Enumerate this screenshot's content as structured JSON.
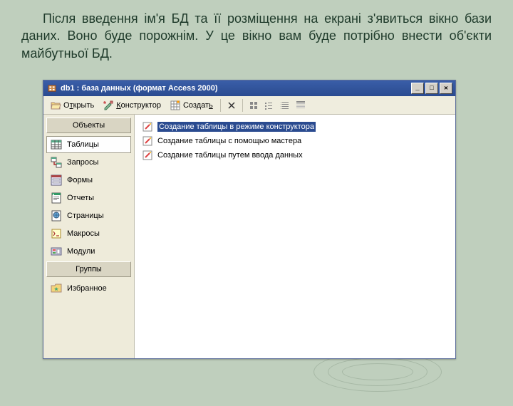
{
  "slide_text": "Після введення ім'я БД та її розміщення на екрані з'явиться вікно бази даних. Воно буде порожнім. У це вікно вам буде потрібно внести об'єкти майбутньої БД.",
  "window": {
    "title": "db1 : база данных (формат Access 2000)"
  },
  "toolbar": {
    "open": "Открыть",
    "open_u": "т",
    "designer": "Конструктор",
    "designer_u": "К",
    "create": "Создать",
    "create_u": "ь"
  },
  "sidebar": {
    "header_objects": "Объекты",
    "header_groups": "Группы",
    "items": [
      {
        "label": "Таблицы"
      },
      {
        "label": "Запросы"
      },
      {
        "label": "Формы"
      },
      {
        "label": "Отчеты"
      },
      {
        "label": "Страницы"
      },
      {
        "label": "Макросы"
      },
      {
        "label": "Модули"
      }
    ],
    "favorites": "Избранное"
  },
  "content": {
    "items": [
      {
        "label": "Создание таблицы в режиме конструктора"
      },
      {
        "label": "Создание таблицы с помощью мастера"
      },
      {
        "label": "Создание таблицы путем ввода данных"
      }
    ]
  }
}
